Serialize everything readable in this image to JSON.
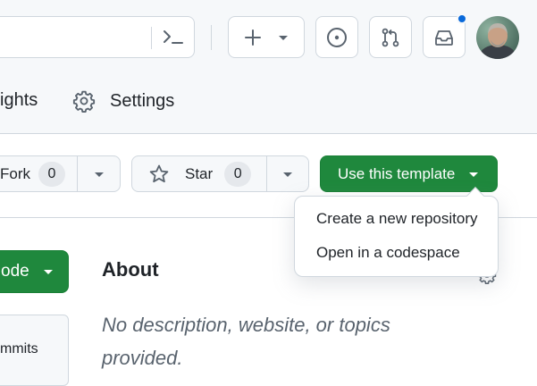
{
  "header": {
    "command_palette_icon": "command-palette-icon",
    "create_icon": "plus-icon",
    "issues_icon": "issue-opened-icon",
    "pulls_icon": "git-pull-request-icon",
    "inbox_icon": "inbox-icon",
    "notification_indicator_color": "#0969da"
  },
  "nav": {
    "insights_label": "ights",
    "settings_label": "Settings"
  },
  "repo_actions": {
    "fork_label": "Fork",
    "fork_count": "0",
    "star_label": "Star",
    "star_count": "0",
    "template_label": "Use this template"
  },
  "template_menu": {
    "items": [
      {
        "label": "Create a new repository"
      },
      {
        "label": "Open in a codespace"
      }
    ]
  },
  "code": {
    "label": "ode",
    "commits_label": "mmits"
  },
  "about": {
    "title": "About",
    "description": "No description, website, or topics provided."
  },
  "colors": {
    "primary_green": "#1f883d",
    "border": "#d0d7de",
    "muted_text": "#59636e"
  }
}
